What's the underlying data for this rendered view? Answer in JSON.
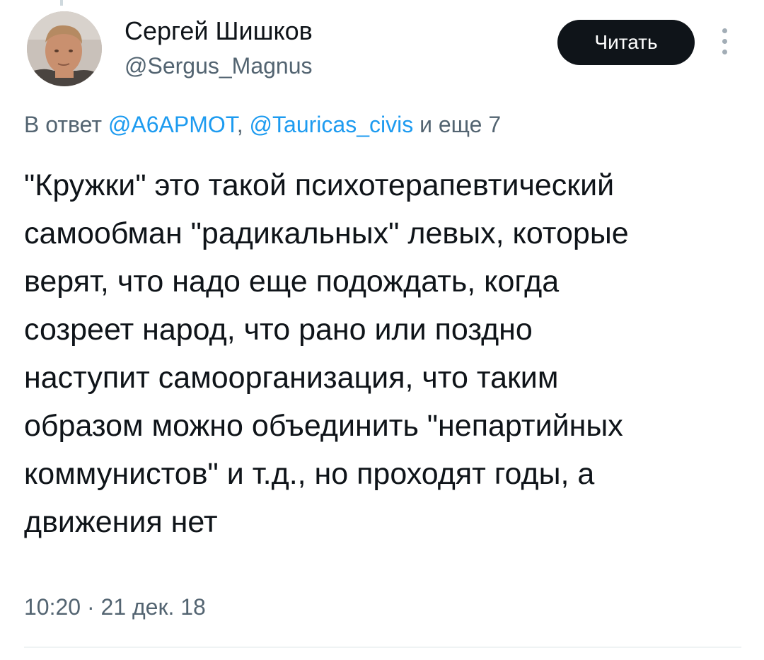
{
  "author": {
    "name": "Сергей Шишков",
    "handle": "@Sergus_Magnus",
    "avatar_icon": "user-photo-avatar"
  },
  "actions": {
    "follow_label": "Читать",
    "more_icon": "more-vertical-icon"
  },
  "reply": {
    "prefix": "В ответ",
    "mention_1": "@A6APMOT",
    "separator": ",",
    "mention_2": "@Tauricas_civis",
    "suffix": "и еще 7"
  },
  "tweet": {
    "lines": [
      "\"Кружки\" это такой психотерапевтический",
      "самообман \"радикальных\" левых, которые",
      "верят, что надо еще подождать, когда",
      "созреет народ, что рано или поздно",
      "наступит самоорганизация, что таким",
      "образом можно объединить \"непартийных",
      "коммунистов\" и т.д., но проходят годы, а",
      "движения нет"
    ],
    "timestamp": "10:20 · 21 дек. 18"
  },
  "colors": {
    "text": "#0f1419",
    "secondary": "#536471",
    "link": "#1d9bf0",
    "button_bg": "#0f1419",
    "button_text": "#ffffff",
    "divider": "#eff3f4"
  }
}
